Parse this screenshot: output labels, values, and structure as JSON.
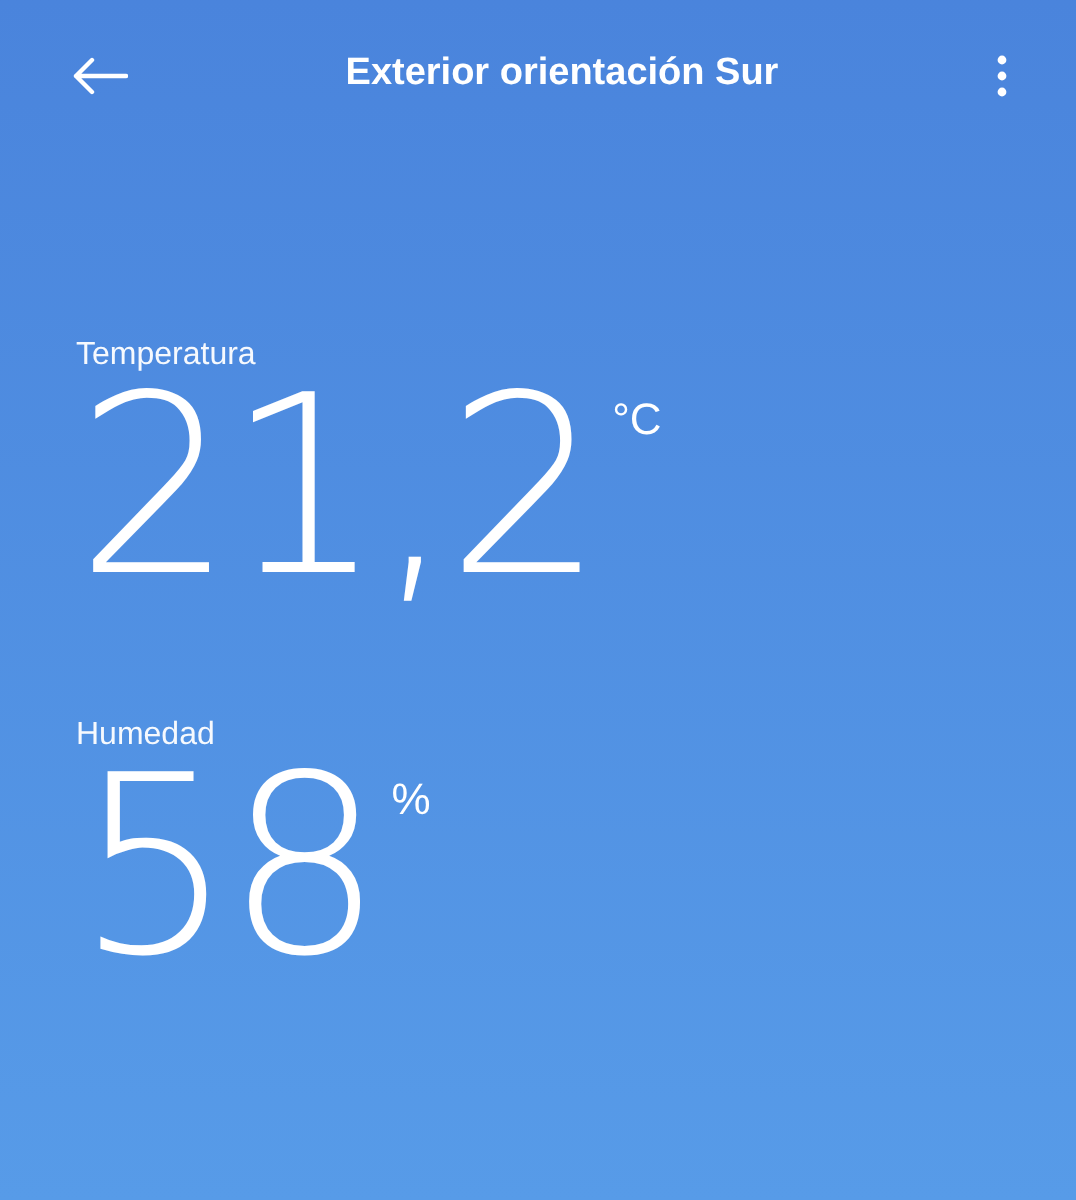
{
  "header": {
    "title": "Exterior orientación Sur"
  },
  "readings": [
    {
      "label": "Temperatura",
      "value": "21,2",
      "unit": "°C"
    },
    {
      "label": "Humedad",
      "value": "58",
      "unit": "%"
    }
  ]
}
